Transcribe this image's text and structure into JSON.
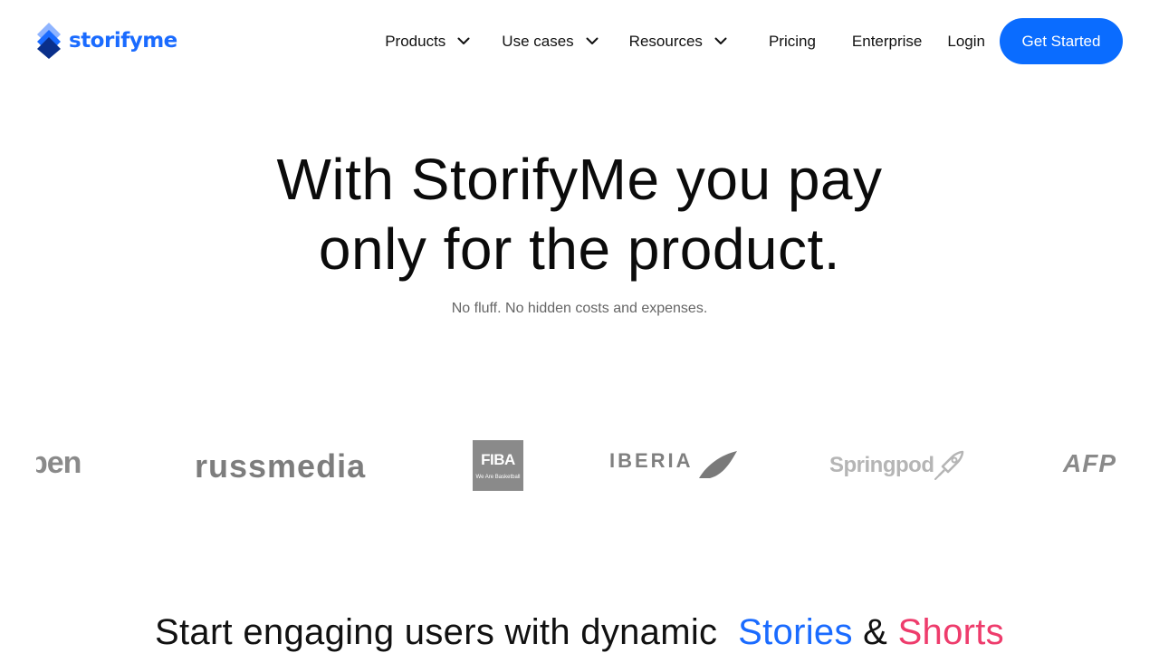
{
  "brand": {
    "name": "storifyme",
    "color": "#1a6bff"
  },
  "nav": {
    "products": "Products",
    "use_cases": "Use cases",
    "resources": "Resources",
    "pricing": "Pricing",
    "enterprise": "Enterprise",
    "login": "Login",
    "cta": "Get Started",
    "cta_color": "#0a6cff",
    "dropdown_icon": "chevron-down-icon"
  },
  "hero": {
    "title_line1": "With StorifyMe you pay",
    "title_line2": "only for the product.",
    "subtitle": "No fluff. No hidden costs and expenses."
  },
  "customers": {
    "logos": [
      "pen",
      "russmedia",
      "FIBA",
      "IBERIA",
      "Springpod",
      "AFP"
    ],
    "fiba_tagline": "We Are Basketball"
  },
  "engage": {
    "prefix": "Start engaging users with dynamic",
    "stories": "Stories",
    "amp": "&",
    "shorts": "Shorts",
    "stories_color": "#1a6bff",
    "shorts_color": "#ee3c6c"
  }
}
